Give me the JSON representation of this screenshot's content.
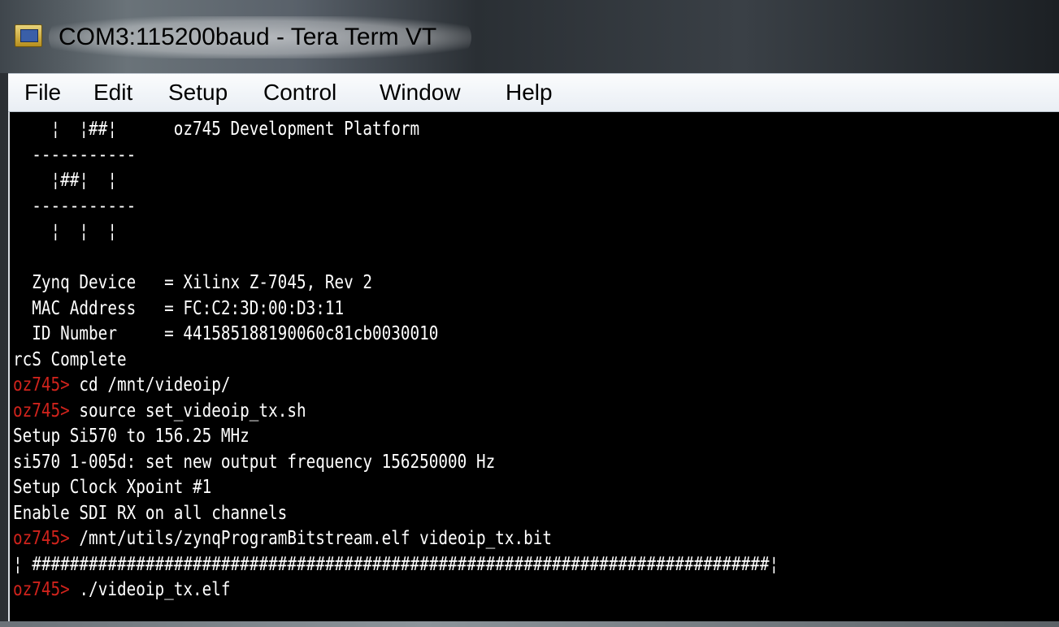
{
  "window": {
    "title": "COM3:115200baud - Tera Term VT",
    "icon": "tera-term-app-icon"
  },
  "menu": [
    {
      "label": "File"
    },
    {
      "label": "Edit"
    },
    {
      "label": "Setup"
    },
    {
      "label": "Control"
    },
    {
      "label": "Window"
    },
    {
      "label": "Help"
    }
  ],
  "colors": {
    "terminal_background": "#000000",
    "terminal_text": "#ffffff",
    "prompt_text": "#d0231c"
  },
  "terminal": {
    "lines": [
      {
        "text": "    ¦  ¦##¦      oz745 Development Platform"
      },
      {
        "text": "  -----------"
      },
      {
        "text": "    ¦##¦  ¦"
      },
      {
        "text": "  -----------"
      },
      {
        "text": "    ¦  ¦  ¦"
      },
      {
        "text": ""
      },
      {
        "text": "  Zynq Device   = Xilinx Z-7045, Rev 2"
      },
      {
        "text": "  MAC Address   = FC:C2:3D:00:D3:11"
      },
      {
        "text": "  ID Number     = 441585188190060c81cb0030010"
      },
      {
        "text": "rcS Complete"
      },
      {
        "prompt": "oz745>",
        "text": " cd /mnt/videoip/"
      },
      {
        "prompt": "oz745>",
        "text": " source set_videoip_tx.sh"
      },
      {
        "text": "Setup Si570 to 156.25 MHz"
      },
      {
        "text": "si570 1-005d: set new output frequency 156250000 Hz"
      },
      {
        "text": "Setup Clock Xpoint #1"
      },
      {
        "text": "Enable SDI RX on all channels"
      },
      {
        "prompt": "oz745>",
        "text": " /mnt/utils/zynqProgramBitstream.elf videoip_tx.bit"
      },
      {
        "text": "¦ ##############################################################################¦"
      },
      {
        "prompt": "oz745>",
        "text": " ./videoip_tx.elf"
      }
    ]
  }
}
